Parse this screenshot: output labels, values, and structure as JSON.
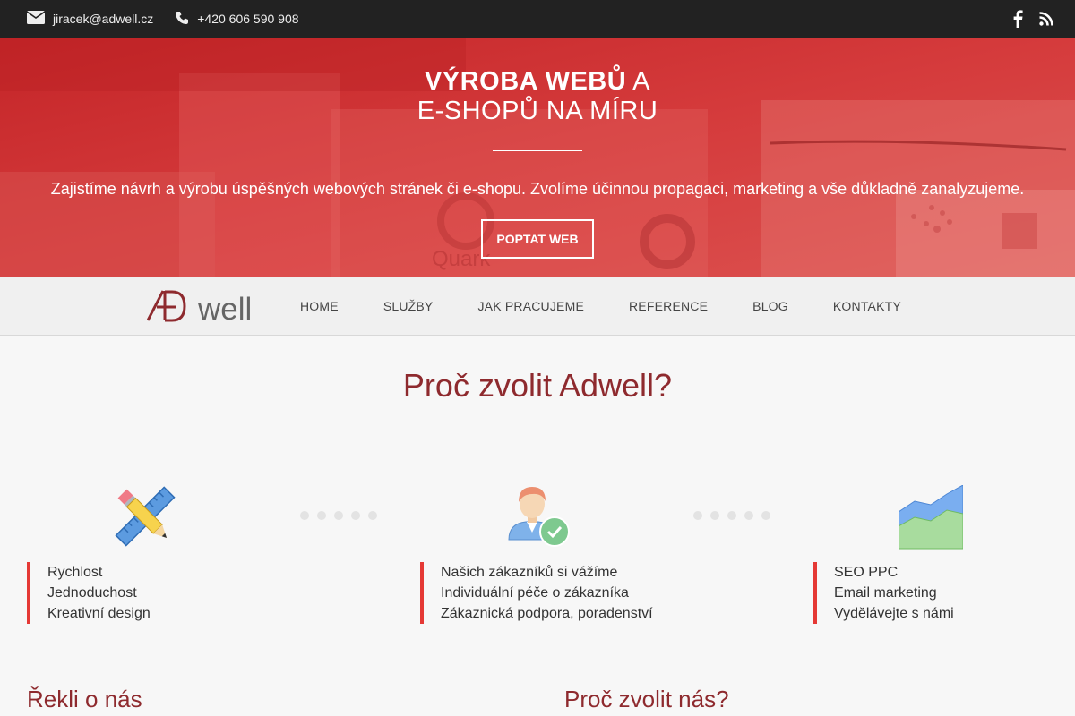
{
  "topbar": {
    "email": "jiracek@adwell.cz",
    "phone": "+420 606 590 908",
    "icons": [
      "envelope-icon",
      "phone-icon",
      "facebook-icon",
      "rss-icon"
    ]
  },
  "hero": {
    "title_bold": "VÝROBA WEBŮ",
    "title_rest": " A",
    "title_line2": "E-SHOPŮ NA MÍRU",
    "lead": "Zajistíme návrh a výrobu úspěšných webových stránek či e-shopu. Zvolíme účinnou propagaci, marketing a vše důkladně zanalyzujeme.",
    "cta": "POPTAT WEB",
    "bg_text": "Quark"
  },
  "nav": {
    "logo_mark": "AD",
    "logo_text": "well",
    "items": [
      "HOME",
      "SLUŽBY",
      "JAK PRACUJEME",
      "REFERENCE",
      "BLOG",
      "KONTAKTY"
    ]
  },
  "why": {
    "title": "Proč zvolit Adwell?",
    "features": [
      {
        "icon": "ruler-pencil-icon",
        "lines": [
          "Rychlost",
          "Jednoduchost",
          "Kreativní design"
        ]
      },
      {
        "icon": "user-check-icon",
        "lines": [
          "Našich zákazníků si vážíme",
          "Individuální péče o zákazníka",
          "Zákaznická podpora, poradenství"
        ]
      },
      {
        "icon": "area-chart-icon",
        "lines": [
          "SEO PPC",
          "Email marketing",
          "Vydělávejte s námi"
        ]
      }
    ]
  },
  "sections": {
    "left_title": "Řekli o nás",
    "right_title": "Proč zvolit nás?"
  },
  "colors": {
    "accent": "#e53935",
    "brand_dark_red": "#8e2a2e",
    "hero_red": "#cf2d2f",
    "topbar": "#222222"
  }
}
